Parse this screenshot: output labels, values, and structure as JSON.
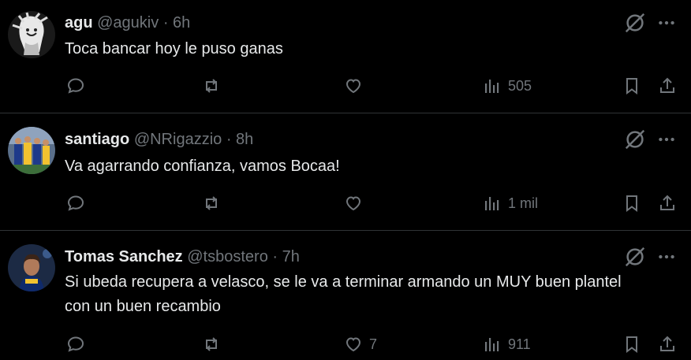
{
  "tweets": [
    {
      "name": "agu",
      "handle": "@agukiv",
      "time": "· 6h",
      "text": "Toca bancar hoy le puso ganas",
      "likes": "",
      "views": "505"
    },
    {
      "name": "santiago",
      "handle": "@NRigazzio",
      "time": "· 8h",
      "text": "Va agarrando confianza, vamos Bocaa!",
      "likes": "",
      "views": "1 mil"
    },
    {
      "name": "Tomas Sanchez",
      "handle": "@tsbostero",
      "time": "· 7h",
      "text": "Si ubeda recupera a velasco, se le va a terminar armando un MUY buen plantel con un buen recambio",
      "likes": "7",
      "views": "911"
    }
  ],
  "colors": {
    "background": "#000000",
    "text": "#e7e9ea",
    "muted": "#71767b",
    "divider": "#2f3336"
  },
  "icons": [
    "reply-icon",
    "retweet-icon",
    "like-icon",
    "views-icon",
    "bookmark-icon",
    "share-icon",
    "grok-icon",
    "more-icon"
  ]
}
